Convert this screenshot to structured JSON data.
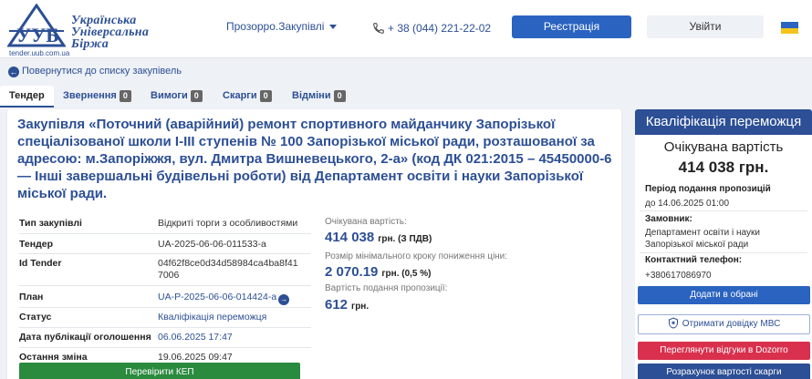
{
  "header": {
    "logo_lines": [
      "Українська",
      "Універсальна",
      "Біржа"
    ],
    "logo_url": "tender.uub.com.ua",
    "nav_dropdown": "Прозорро.Закупівлі",
    "phone": "+ 38 (044) 221-22-02",
    "register_label": "Реєстрація",
    "login_label": "Увійти"
  },
  "back_link": "Повернутися до списку закупівель",
  "tabs": [
    {
      "label": "Тендер",
      "count": ""
    },
    {
      "label": "Звернення",
      "count": "0"
    },
    {
      "label": "Вимоги",
      "count": "0"
    },
    {
      "label": "Скарги",
      "count": "0"
    },
    {
      "label": "Відміни",
      "count": "0"
    }
  ],
  "tender": {
    "title": "Закупівля «Поточний (аварійний) ремонт спортивного майданчику Запорізької спеціалізованої школи І-ІІІ ступенів № 100 Запорізької міської ради, розташованої за адресою: м.Запоріжжя, вул. Дмитра Вишневецького, 2-а» (код ДК 021:2015 – 45450000-6 — Інші завершальні будівельні роботи) від Департамент освіти і науки Запорізької міської ради.",
    "info": [
      {
        "key": "Тип закупівлі",
        "value": "Відкриті торги з особливостями"
      },
      {
        "key": "Тендер",
        "value": "UA-2025-06-06-011533-a"
      },
      {
        "key": "Id Tender",
        "value": "04f62f8ce0d34d58984ca4ba8f417006"
      },
      {
        "key": "План",
        "value": "UA-P-2025-06-06-014424-a"
      },
      {
        "key": "Статус",
        "value": "Кваліфікація переможця"
      },
      {
        "key": "Дата публікації оголошення",
        "value": "06.06.2025 17:47"
      },
      {
        "key": "Остання зміна",
        "value": "19.06.2025 09:47"
      }
    ],
    "check_kep_label": "Перевірити КЕП",
    "expected_label": "Очікувана вартість:",
    "expected_value": "414 038",
    "expected_unit": "грн. (З ПДВ)",
    "min_step_label": "Розмір мінімального кроку пониження ціни:",
    "min_step_value": "2 070.19",
    "min_step_unit": "грн. (0,5 %)",
    "fee_label": "Вартість подання пропозиції:",
    "fee_value": "612",
    "fee_unit": "грн."
  },
  "side": {
    "header": "Кваліфікація переможця",
    "expected_label": "Очікувана вартість",
    "expected_value": "414 038 грн.",
    "period_label": "Період подання пропозицій",
    "period_value": "до 14.06.2025 01:00",
    "customer_label": "Замовник:",
    "customer_value": "Департамент освіти і науки Запорізької міської ради",
    "phone_label": "Контактний телефон:",
    "phone_value": "+380617086970",
    "btn_favorites": "Додати в обрані",
    "btn_mvs": "Отримати довідку МВС",
    "btn_dozorro": "Переглянути відгуки в Dozorro",
    "btn_complaint": "Розрахунок вартості скарги"
  },
  "colors": {
    "primary": "#2c4f95",
    "button": "#2a63c0",
    "green": "#2a8a3e",
    "red": "#d9304d"
  }
}
